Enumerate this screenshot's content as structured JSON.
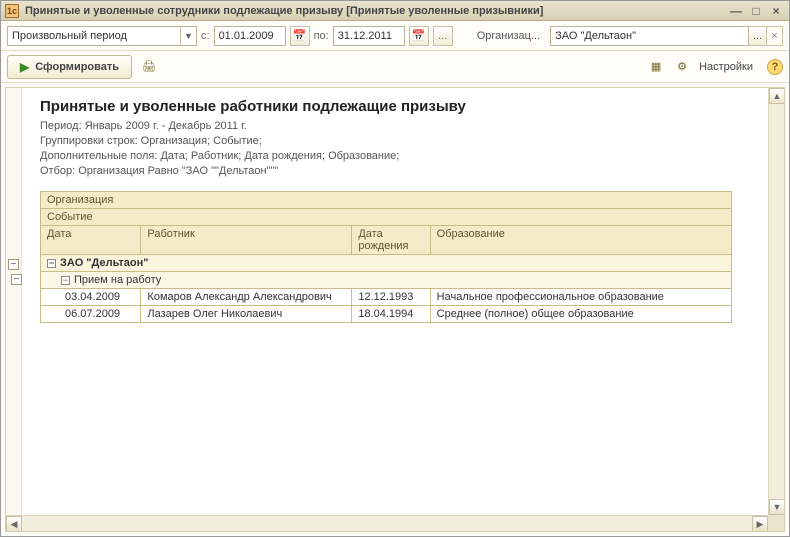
{
  "window": {
    "title": "Принятые и уволенные сотрудники подлежащие призыву [Принятые уволенные призывники]",
    "icon_label": "1c"
  },
  "filter": {
    "period_mode": "Произвольный период",
    "from_label": "с:",
    "from_date": "01.01.2009",
    "to_label": "по:",
    "to_date": "31.12.2011",
    "quick_btn": "...",
    "org_label": "Организац...",
    "org_value": "ЗАО \"Дельтаон\"",
    "org_more": "...",
    "org_clear": "×"
  },
  "toolbar": {
    "form_label": "Сформировать",
    "settings_label": "Настройки"
  },
  "report": {
    "title": "Принятые и уволенные работники подлежащие призыву",
    "meta_period": "Период: Январь 2009 г. - Декабрь 2011 г.",
    "meta_groups": "Группировки строк: Организация; Событие;",
    "meta_fields": "Дополнительные поля: Дата; Работник; Дата рождения; Образование;",
    "meta_filter": "Отбор: Организация Равно \"ЗАО \"\"Дельтаон\"\"\"",
    "headers": {
      "org": "Организация",
      "event": "Событие",
      "date": "Дата",
      "worker": "Работник",
      "bdate": "Дата рождения",
      "edu": "Образование"
    },
    "group_org": "ЗАО \"Дельтаон\"",
    "group_event": "Прием на работу",
    "rows": [
      {
        "date": "03.04.2009",
        "worker": "Комаров Александр Александрович",
        "bdate": "12.12.1993",
        "edu": "Начальное профессиональное образование"
      },
      {
        "date": "06.07.2009",
        "worker": "Лазарев Олег Николаевич",
        "bdate": "18.04.1994",
        "edu": "Среднее (полное) общее образование"
      }
    ]
  },
  "glyphs": {
    "minus": "−",
    "win_min": "—",
    "win_max": "□",
    "win_close": "×",
    "dd": "▼",
    "cal": "📅",
    "play": "▶",
    "print": "🖨",
    "grid": "▦",
    "cog": "⚙",
    "help": "?",
    "up": "▲",
    "down": "▼",
    "left": "◀",
    "right": "▶"
  }
}
